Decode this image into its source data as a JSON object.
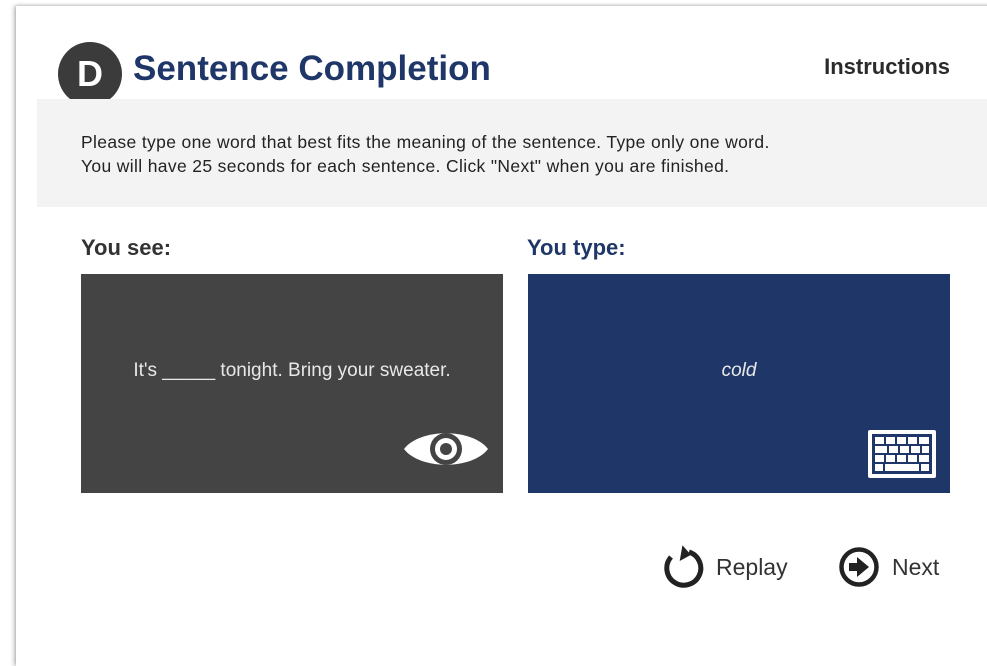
{
  "header": {
    "badge_letter": "D",
    "title": "Sentence Completion",
    "instructions_label": "Instructions"
  },
  "instructions": {
    "line1": "Please type one word that best fits the meaning of the sentence. Type only one word.",
    "line2": "You will have 25 seconds for each sentence. Click \"Next\" when you are finished."
  },
  "see_panel": {
    "label": "You see:",
    "sentence_before": "It's",
    "sentence_blank": "_____",
    "sentence_after": "tonight. Bring your sweater.",
    "icon": "eye-icon"
  },
  "type_panel": {
    "label": "You type:",
    "typed_text": "cold",
    "icon": "keyboard-icon"
  },
  "actions": {
    "replay_label": "Replay",
    "replay_icon": "replay-icon",
    "next_label": "Next",
    "next_icon": "arrow-right-circle-icon"
  },
  "colors": {
    "title": "#1f3668",
    "badge": "#3b3b3b",
    "see_panel_bg": "#444444",
    "type_panel_bg": "#1f3668",
    "instruction_bg": "#f3f3f3"
  }
}
